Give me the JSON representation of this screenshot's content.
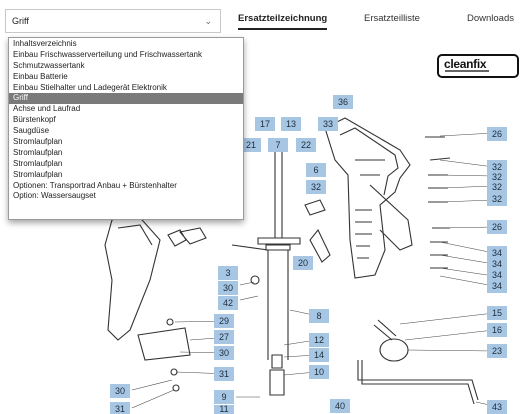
{
  "select": {
    "value": "Griff",
    "chevron_icon": "chevron-down-icon"
  },
  "tabs": [
    {
      "label": "Ersatzteilzeichnung",
      "active": true
    },
    {
      "label": "Ersatzteilliste",
      "active": false
    },
    {
      "label": "Downloads",
      "active": false
    }
  ],
  "dropdown": {
    "items": [
      "Inhaltsverzeichnis",
      "Einbau Frischwasserverteilung und Frischwassertank",
      "Schmutzwassertank",
      "Einbau Batterie",
      "Einbau Stielhalter und Ladegerät Elektronik",
      "Griff",
      "Achse und Laufrad",
      "Bürstenkopf",
      "Saugdüse",
      "Stromlaufplan",
      "Stromlaufplan",
      "Stromlaufplan",
      "Stromlaufplan",
      "Optionen: Transportrad Anbau + Bürstenhalter",
      "Option: Wassersaugset"
    ],
    "selected_index": 5
  },
  "logo": {
    "text": "cleanfix"
  },
  "part_numbers": [
    "36",
    "17",
    "13",
    "33",
    "21",
    "7",
    "22",
    "26",
    "6",
    "32",
    "32",
    "32",
    "32",
    "32",
    "26",
    "34",
    "34",
    "34",
    "34",
    "20",
    "3",
    "30",
    "42",
    "8",
    "29",
    "27",
    "30",
    "12",
    "14",
    "10",
    "15",
    "16",
    "23",
    "30",
    "31",
    "9",
    "40",
    "43",
    "31",
    "11"
  ],
  "colors": {
    "label_bg": "#a7c6e4",
    "selected_bg": "#7a7a7a",
    "line": "#333333"
  }
}
